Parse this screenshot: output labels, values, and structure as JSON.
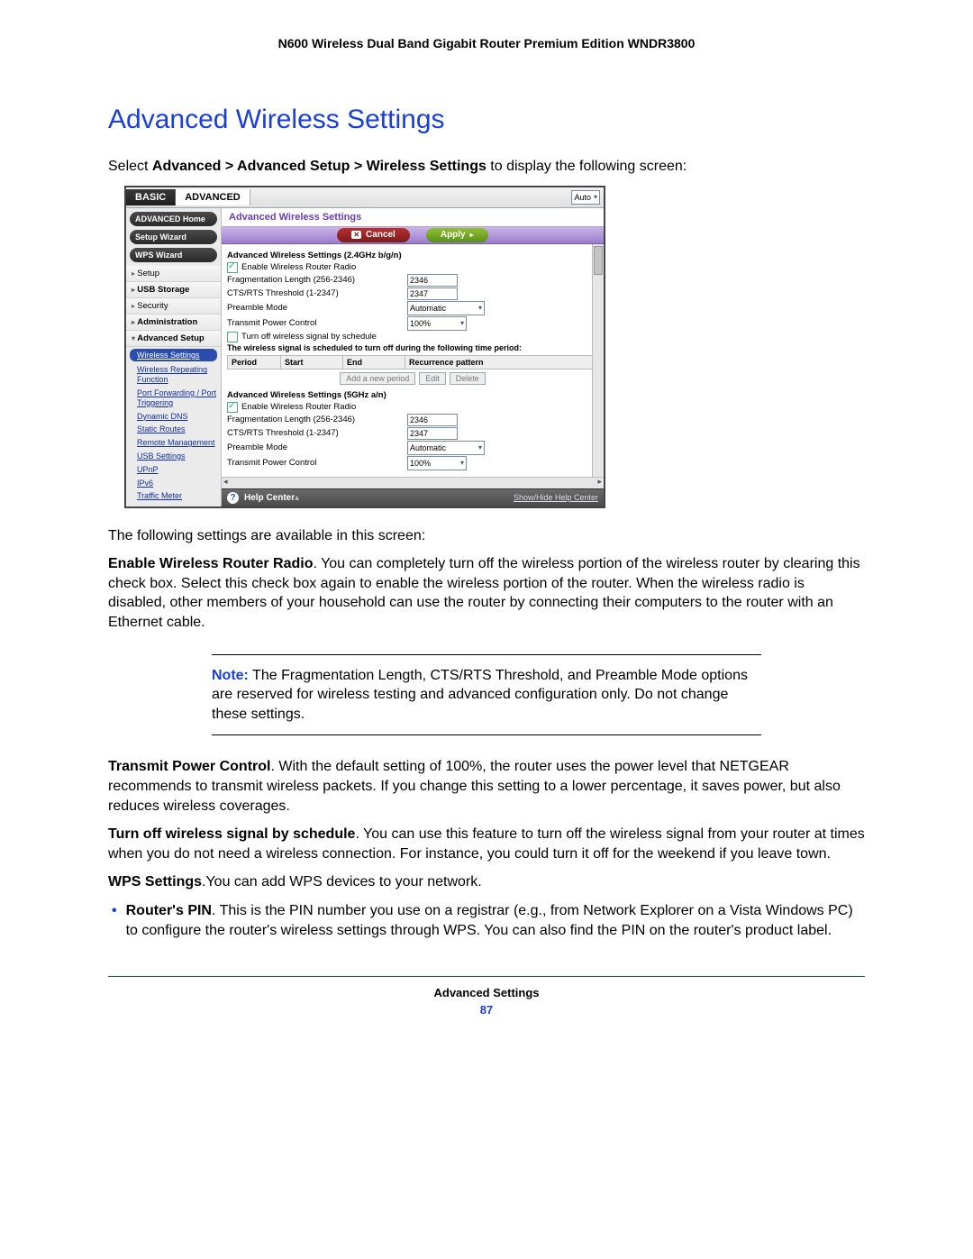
{
  "doc_header": "N600 Wireless Dual Band Gigabit Router Premium Edition WNDR3800",
  "section_title": "Advanced Wireless Settings",
  "intro": {
    "pre": "Select ",
    "path": "Advanced > Advanced Setup > Wireless Settings",
    "post": " to display the following screen:"
  },
  "para_available": "The following settings are available in this screen:",
  "enable_radio": {
    "label": "Enable Wireless Router Radio",
    "text": ". You can completely turn off the wireless portion of the wireless router by clearing this check box. Select this check box again to enable the wireless portion of the router. When the wireless radio is disabled, other members of your household can use the router by connecting their computers to the router with an Ethernet cable."
  },
  "note": {
    "label": "Note:",
    "text": "The Fragmentation Length, CTS/RTS Threshold, and Preamble Mode options are reserved for wireless testing and advanced configuration only. Do not change these settings."
  },
  "tpc": {
    "label": "Transmit Power Control",
    "text": ". With the default setting of 100%, the router uses the power level that NETGEAR recommends to transmit wireless packets. If you change this setting to a lower percentage, it saves power, but also reduces wireless coverages."
  },
  "schedule_off": {
    "label": "Turn off wireless signal by schedule",
    "text": ". You can use this feature to turn off the wireless signal from your router at times when you do not need a wireless connection. For instance, you could turn it off for the weekend if you leave town."
  },
  "wps": {
    "label": "WPS Settings",
    "text": ".You can add WPS devices to your network."
  },
  "routers_pin": {
    "label": "Router's PIN",
    "text": ". This is the PIN number you use on a registrar (e.g., from Network Explorer on a Vista Windows PC) to configure the router's wireless settings through WPS. You can also find the PIN on the router's product label."
  },
  "footer": {
    "label": "Advanced Settings",
    "page": "87"
  },
  "ui": {
    "tabs": {
      "basic": "BASIC",
      "advanced": "ADVANCED"
    },
    "top_select": "Auto",
    "sidebar_pills": [
      "ADVANCED Home",
      "Setup Wizard",
      "WPS Wizard"
    ],
    "sidebar_items": [
      "Setup",
      "USB Storage",
      "Security",
      "Administration",
      "Advanced Setup"
    ],
    "sidebar_subs": [
      "Wireless Settings",
      "Wireless Repeating Function",
      "Port Forwarding / Port Triggering",
      "Dynamic DNS",
      "Static Routes",
      "Remote Management",
      "USB Settings",
      "UPnP",
      "IPv6",
      "Traffic Meter"
    ],
    "main_title": "Advanced Wireless Settings",
    "btn_cancel": "Cancel",
    "btn_apply": "Apply",
    "group24_title": "Advanced Wireless Settings (2.4GHz b/g/n)",
    "group5_title": "Advanced Wireless Settings (5GHz a/n)",
    "enable_label": "Enable Wireless Router Radio",
    "frag_label": "Fragmentation Length (256-2346)",
    "frag_value": "2346",
    "cts_label": "CTS/RTS Threshold (1-2347)",
    "cts_value": "2347",
    "preamble_label": "Preamble Mode",
    "preamble_value": "Automatic",
    "tpc_label": "Transmit Power Control",
    "tpc_value": "100%",
    "turnoff_label": "Turn off wireless signal by schedule",
    "sched_note": "The wireless signal is scheduled to turn off during the following time period:",
    "sched_cols": [
      "Period",
      "Start",
      "End",
      "Recurrence pattern"
    ],
    "sched_btns": {
      "add": "Add a new period",
      "edit": "Edit",
      "del": "Delete"
    },
    "helpcenter": "Help Center",
    "showhide": "Show/Hide Help Center"
  }
}
